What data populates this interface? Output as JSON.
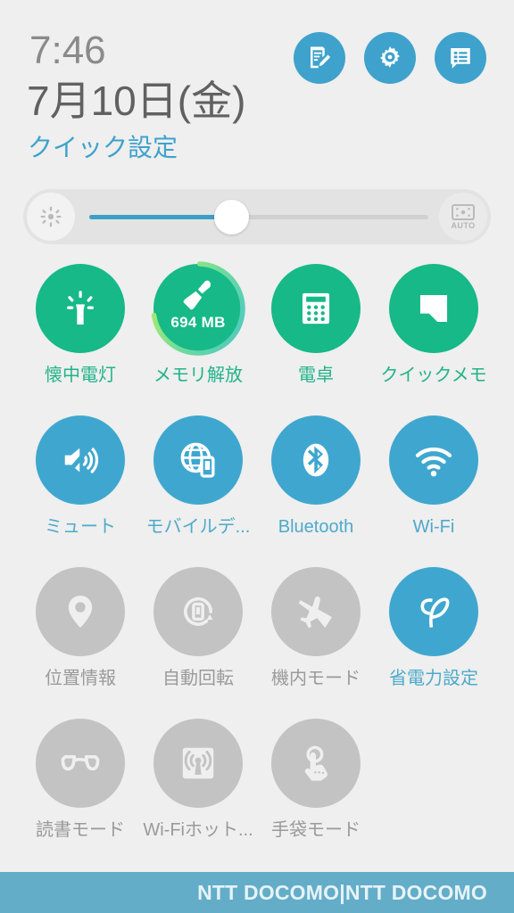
{
  "status": {
    "clock": "7:46",
    "date": "7月10日(金)",
    "panel_title": "クイック設定"
  },
  "header": {
    "buttons": [
      {
        "label": "編集",
        "icon": "note-edit-icon",
        "name": "edit-button"
      },
      {
        "label": "設定",
        "icon": "gear-icon",
        "name": "settings-button"
      },
      {
        "label": "通知",
        "icon": "notification-list-icon",
        "name": "notifications-button"
      }
    ],
    "accent_color": "#3fa2cc"
  },
  "brightness": {
    "left_icon": "brightness-sun-icon",
    "right_icon": "auto-brightness-icon",
    "auto_label": "AUTO",
    "value_percent": 42,
    "fill_color": "#3d9fc8",
    "track_color": "#cfd0cf"
  },
  "tiles": {
    "colors": {
      "on_green": "#16b987",
      "on_blue": "#3fa7cf",
      "off_gray": "#c3c3c3",
      "label_green": "#23b389",
      "label_blue": "#4fa9cc",
      "label_gray": "#9a9a9a"
    },
    "rows": [
      [
        {
          "label": "懐中電灯",
          "icon": "flashlight-icon",
          "state": "on-green"
        },
        {
          "label": "メモリ解放",
          "icon": "broom-icon",
          "state": "on-green",
          "badge": "694 MB",
          "ring_percent": 72
        },
        {
          "label": "電卓",
          "icon": "calculator-icon",
          "state": "on-green"
        },
        {
          "label": "クイックメモ",
          "icon": "quick-memo-icon",
          "state": "on-green"
        }
      ],
      [
        {
          "label": "ミュート",
          "icon": "mute-speaker-icon",
          "state": "on-blue"
        },
        {
          "label": "モバイルデ...",
          "icon": "mobile-data-icon",
          "state": "on-blue"
        },
        {
          "label": "Bluetooth",
          "icon": "bluetooth-icon",
          "state": "on-blue"
        },
        {
          "label": "Wi-Fi",
          "icon": "wifi-icon",
          "state": "on-blue"
        }
      ],
      [
        {
          "label": "位置情報",
          "icon": "location-pin-icon",
          "state": "off"
        },
        {
          "label": "自動回転",
          "icon": "auto-rotate-icon",
          "state": "off"
        },
        {
          "label": "機内モード",
          "icon": "airplane-icon",
          "state": "off"
        },
        {
          "label": "省電力設定",
          "icon": "leaf-icon",
          "state": "on-blue"
        }
      ],
      [
        {
          "label": "読書モード",
          "icon": "glasses-icon",
          "state": "off"
        },
        {
          "label": "Wi-Fiホット...",
          "icon": "hotspot-icon",
          "state": "off"
        },
        {
          "label": "手袋モード",
          "icon": "glove-touch-icon",
          "state": "off"
        },
        {
          "label": "",
          "icon": "",
          "state": "empty"
        }
      ]
    ]
  },
  "bottom_bar": {
    "carrier": "NTT DOCOMO|NTT DOCOMO",
    "background_color": "#64adc8"
  }
}
